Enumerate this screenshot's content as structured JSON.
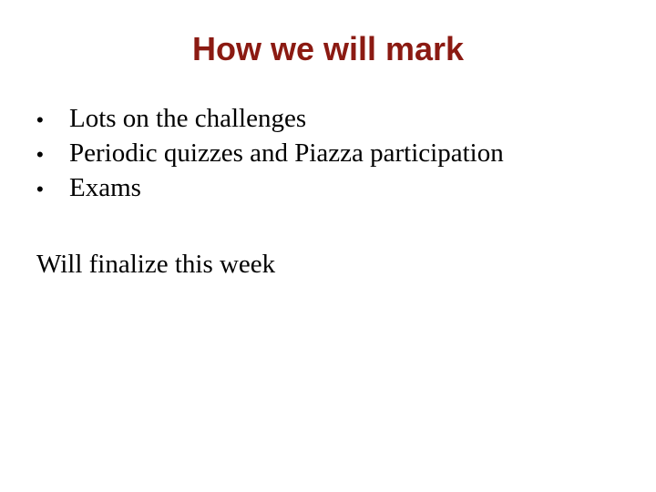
{
  "slide": {
    "title": "How we will mark",
    "title_color": "#8b1a12",
    "bullet_glyph": "•",
    "bullets": [
      "Lots on the challenges",
      "Periodic quizzes and Piazza participation",
      "Exams"
    ],
    "note": "Will finalize this week"
  }
}
